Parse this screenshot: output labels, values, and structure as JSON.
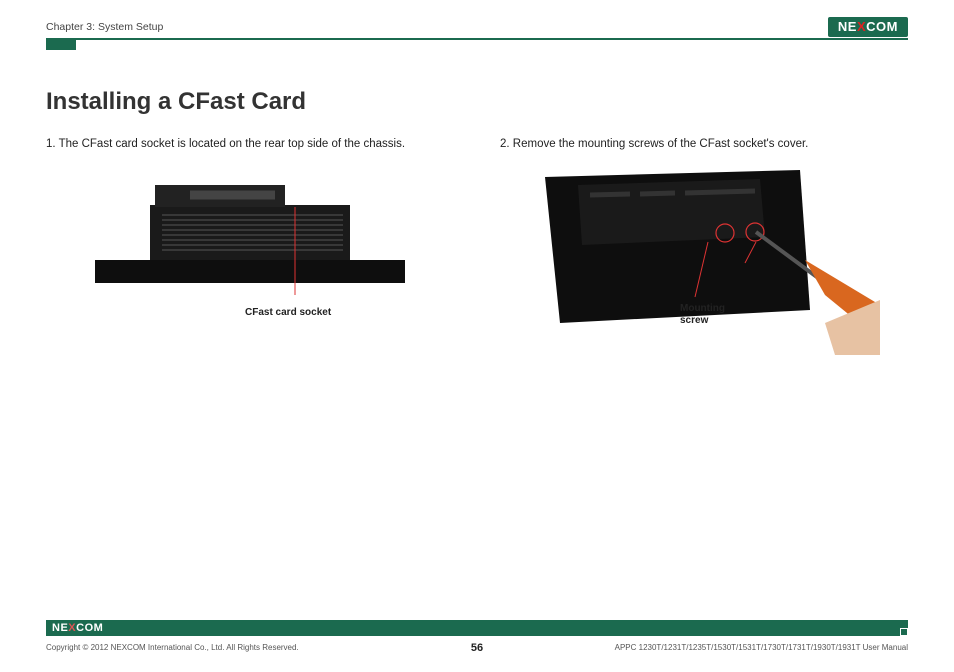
{
  "header": {
    "chapter": "Chapter 3: System Setup",
    "brand_pre": "NE",
    "brand_x": "X",
    "brand_post": "COM"
  },
  "title": "Installing a CFast Card",
  "steps": {
    "s1": "1. The CFast card socket is located on the rear top side of the chassis.",
    "s2": "2. Remove the mounting screws of the CFast socket's cover."
  },
  "captions": {
    "c1": "CFast card socket",
    "c2a": "Mounting",
    "c2b": "screw"
  },
  "footer": {
    "copyright": "Copyright © 2012 NEXCOM International Co., Ltd. All Rights Reserved.",
    "page": "56",
    "manual": "APPC 1230T/1231T/1235T/1530T/1531T/1730T/1731T/1930T/1931T User Manual"
  }
}
